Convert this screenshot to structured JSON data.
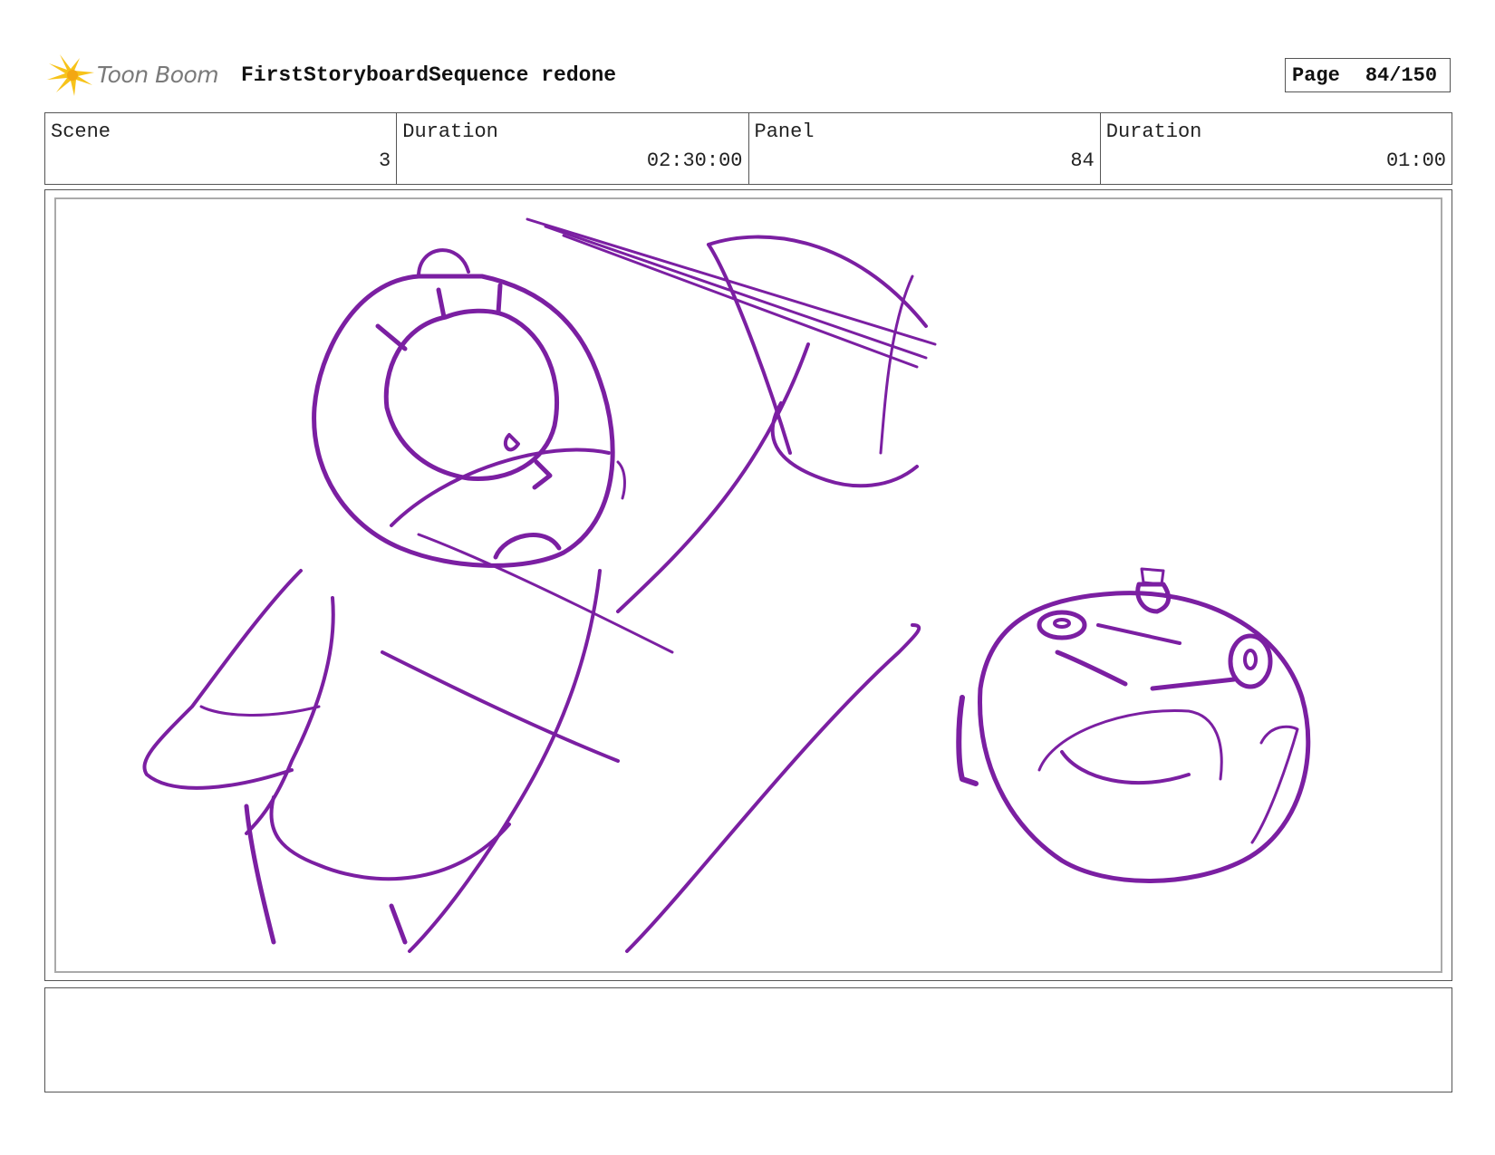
{
  "header": {
    "logo_text": "Toon Boom",
    "title": "FirstStoryboardSequence redone",
    "page_label": "Page",
    "page_value": "84/150"
  },
  "info": {
    "scene_label": "Scene",
    "scene_value": "3",
    "scene_duration_label": "Duration",
    "scene_duration_value": "02:30:00",
    "panel_label": "Panel",
    "panel_value": "84",
    "panel_duration_label": "Duration",
    "panel_duration_value": "01:00"
  },
  "panel": {
    "sketch_color": "#7b1fa2",
    "description": ""
  },
  "notes": {
    "text": ""
  },
  "colors": {
    "logo_yellow": "#f7c31a",
    "border": "#555555"
  }
}
